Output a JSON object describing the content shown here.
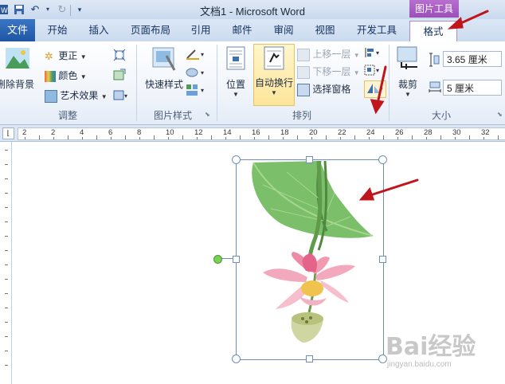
{
  "window": {
    "title": "文档1 - Microsoft Word"
  },
  "context_group": "图片工具",
  "tabs": {
    "file": "文件",
    "home": "开始",
    "insert": "插入",
    "layout": "页面布局",
    "references": "引用",
    "mailings": "邮件",
    "review": "审阅",
    "view": "视图",
    "developer": "开发工具",
    "format": "格式"
  },
  "groups": {
    "adjust": {
      "label": "调整",
      "remove_bg": "删除背景",
      "corrections": "更正",
      "color": "颜色",
      "artistic": "艺术效果"
    },
    "styles": {
      "label": "图片样式",
      "quick_styles": "快速样式"
    },
    "arrange": {
      "label": "排列",
      "position": "位置",
      "wrap_text": "自动换行",
      "bring_forward": "上移一层",
      "send_backward": "下移一层",
      "selection_pane": "选择窗格"
    },
    "size": {
      "label": "大小",
      "crop": "裁剪",
      "height": "3.65 厘米",
      "width": "5 厘米"
    }
  },
  "ruler": {
    "numbers": [
      "2",
      "2",
      "4",
      "6",
      "8",
      "10",
      "12",
      "14",
      "16",
      "18",
      "20",
      "22",
      "24",
      "26",
      "28",
      "30",
      "32"
    ]
  },
  "watermark": {
    "brand": "Bai经验",
    "url": "jingyan.baidu.com"
  },
  "colors": {
    "accent": "#1f56a6",
    "context": "#9b4fb8",
    "arrow": "#c0151b",
    "selection": "#fde59a"
  }
}
